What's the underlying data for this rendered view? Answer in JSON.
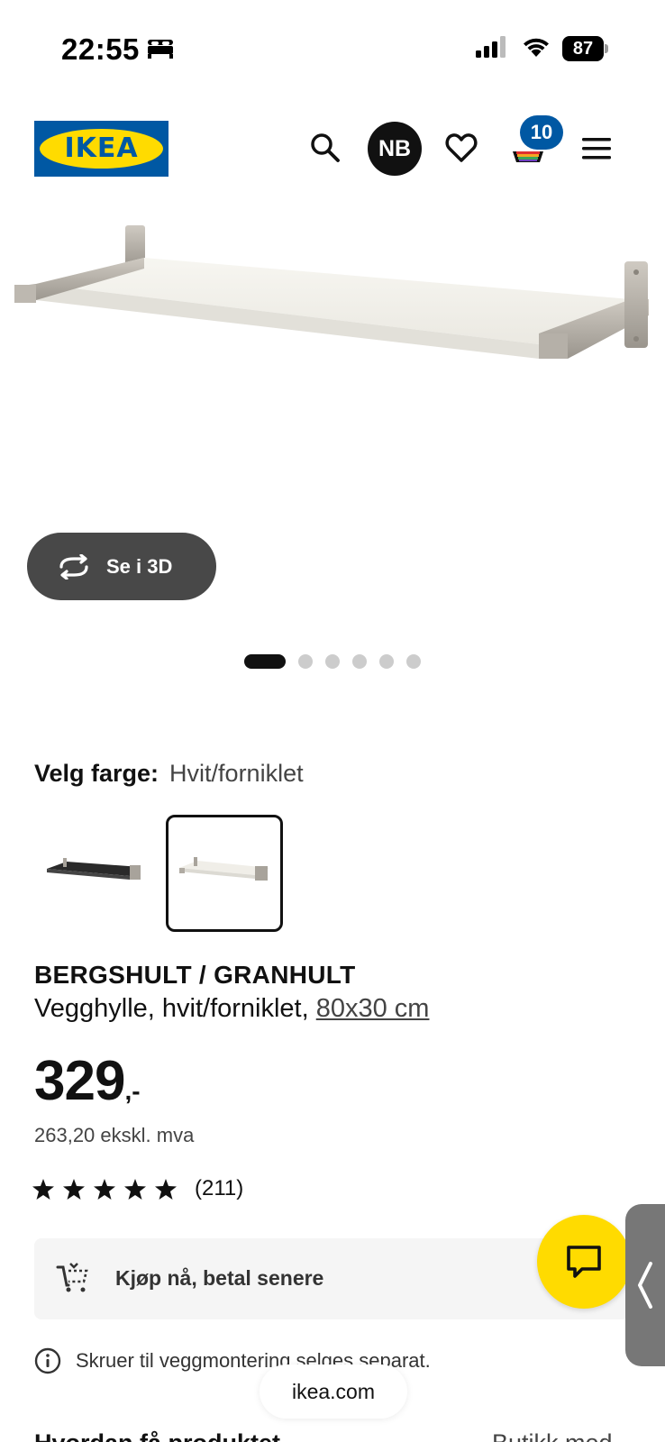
{
  "status_bar": {
    "time": "22:55",
    "battery": "87"
  },
  "header": {
    "logo_text": "IKEA",
    "avatar_initials": "NB",
    "cart_count": "10"
  },
  "gallery": {
    "view_3d_label": "Se i 3D",
    "dot_count": 6,
    "active_dot": 0
  },
  "color_picker": {
    "label": "Velg farge:",
    "value": "Hvit/forniklet"
  },
  "product": {
    "name": "BERGSHULT / GRANHULT",
    "description": "Vegghylle, hvit/forniklet,",
    "size_link": "80x30 cm",
    "price": "329",
    "price_suffix": ",-",
    "price_ex_vat": "263,20 ekskl. mva",
    "rating_stars": 5,
    "review_count": "(211)"
  },
  "pay_later": {
    "label": "Kjøp nå, betal senere"
  },
  "notice": {
    "text": "Skruer til veggmontering selges separat."
  },
  "browser": {
    "url": "ikea.com"
  },
  "bottom": {
    "left_text": "Hvordan få produktet",
    "right_text": "Butikk med"
  },
  "colors": {
    "ikea_blue": "#0058a3",
    "ikea_yellow": "#ffdb00",
    "dark_button": "#484848"
  }
}
